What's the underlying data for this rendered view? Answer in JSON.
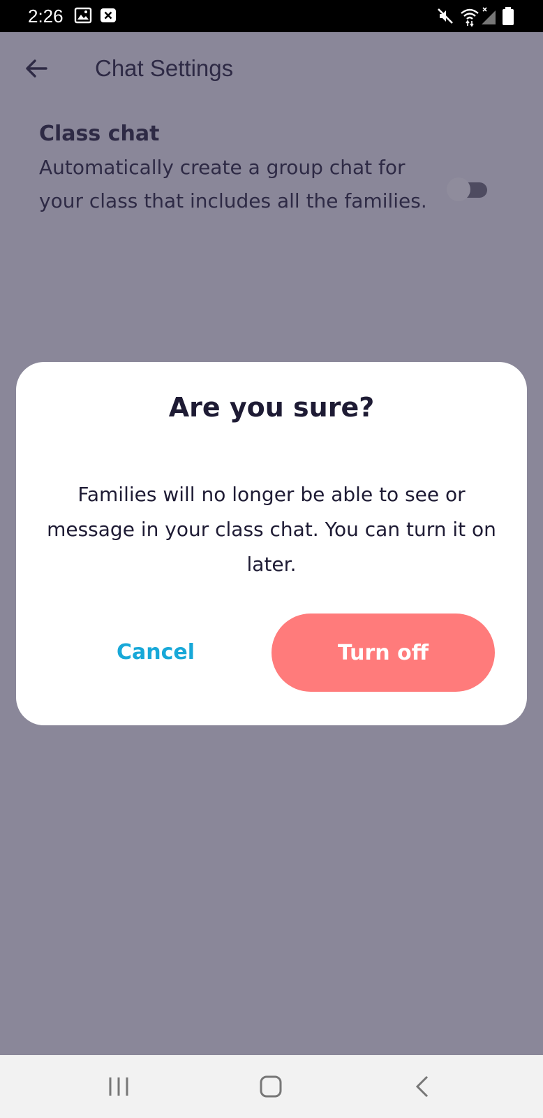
{
  "status_bar": {
    "time": "2:26",
    "icons": [
      "image-icon",
      "close-box-icon",
      "mute-icon",
      "wifi-icon",
      "signal-icon",
      "battery-icon"
    ]
  },
  "header": {
    "title": "Chat Settings"
  },
  "setting": {
    "title": "Class chat",
    "description": "Automatically create a group chat for your class that includes all the families.",
    "enabled": false
  },
  "dialog": {
    "title": "Are you sure?",
    "body": "Families will no longer be able to see or message in your class chat. You can turn it on later.",
    "cancel_label": "Cancel",
    "confirm_label": "Turn off"
  },
  "nav_bar": {
    "icons": [
      "recent-apps-icon",
      "home-icon",
      "back-nav-icon"
    ]
  },
  "colors": {
    "overlay_bg": "#8a8799",
    "cancel_text": "#18a8d8",
    "confirm_bg": "#ff7b7b",
    "title_text": "#1e1b34"
  }
}
